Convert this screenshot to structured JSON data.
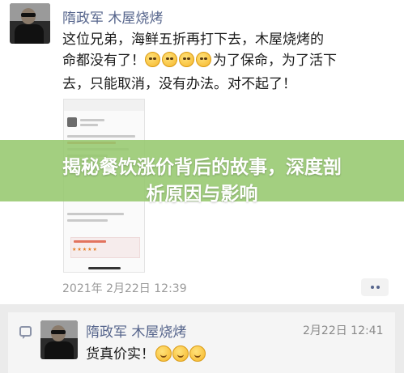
{
  "post": {
    "author": "隋政军 木屋烧烤",
    "text_line1": "这位兄弟，海鲜五折再打下去，木屋烧烤的",
    "text_line2a": "命都没有了！",
    "text_line2b": "为了保命，为了活下",
    "text_line3": "去，只能取消，没有办法。对不起了！",
    "emoji_icon": "crying-face-icon",
    "timestamp": "2021年 2月22日 12:39",
    "more_icon": "more-dots-icon"
  },
  "banner": {
    "title": "揭秘餐饮涨价背后的故事，深度剖析原因与影响",
    "color": "#96c86e"
  },
  "comment": {
    "author": "隋政军 木屋烧烤",
    "time": "2月22日 12:41",
    "text": "货真价实！",
    "emoji_icon": "thumbs-up-face-icon",
    "icon": "comment-icon"
  },
  "colors": {
    "author_name": "#56658c",
    "timestamp": "#9a9a9a",
    "background": "#ebebeb"
  }
}
